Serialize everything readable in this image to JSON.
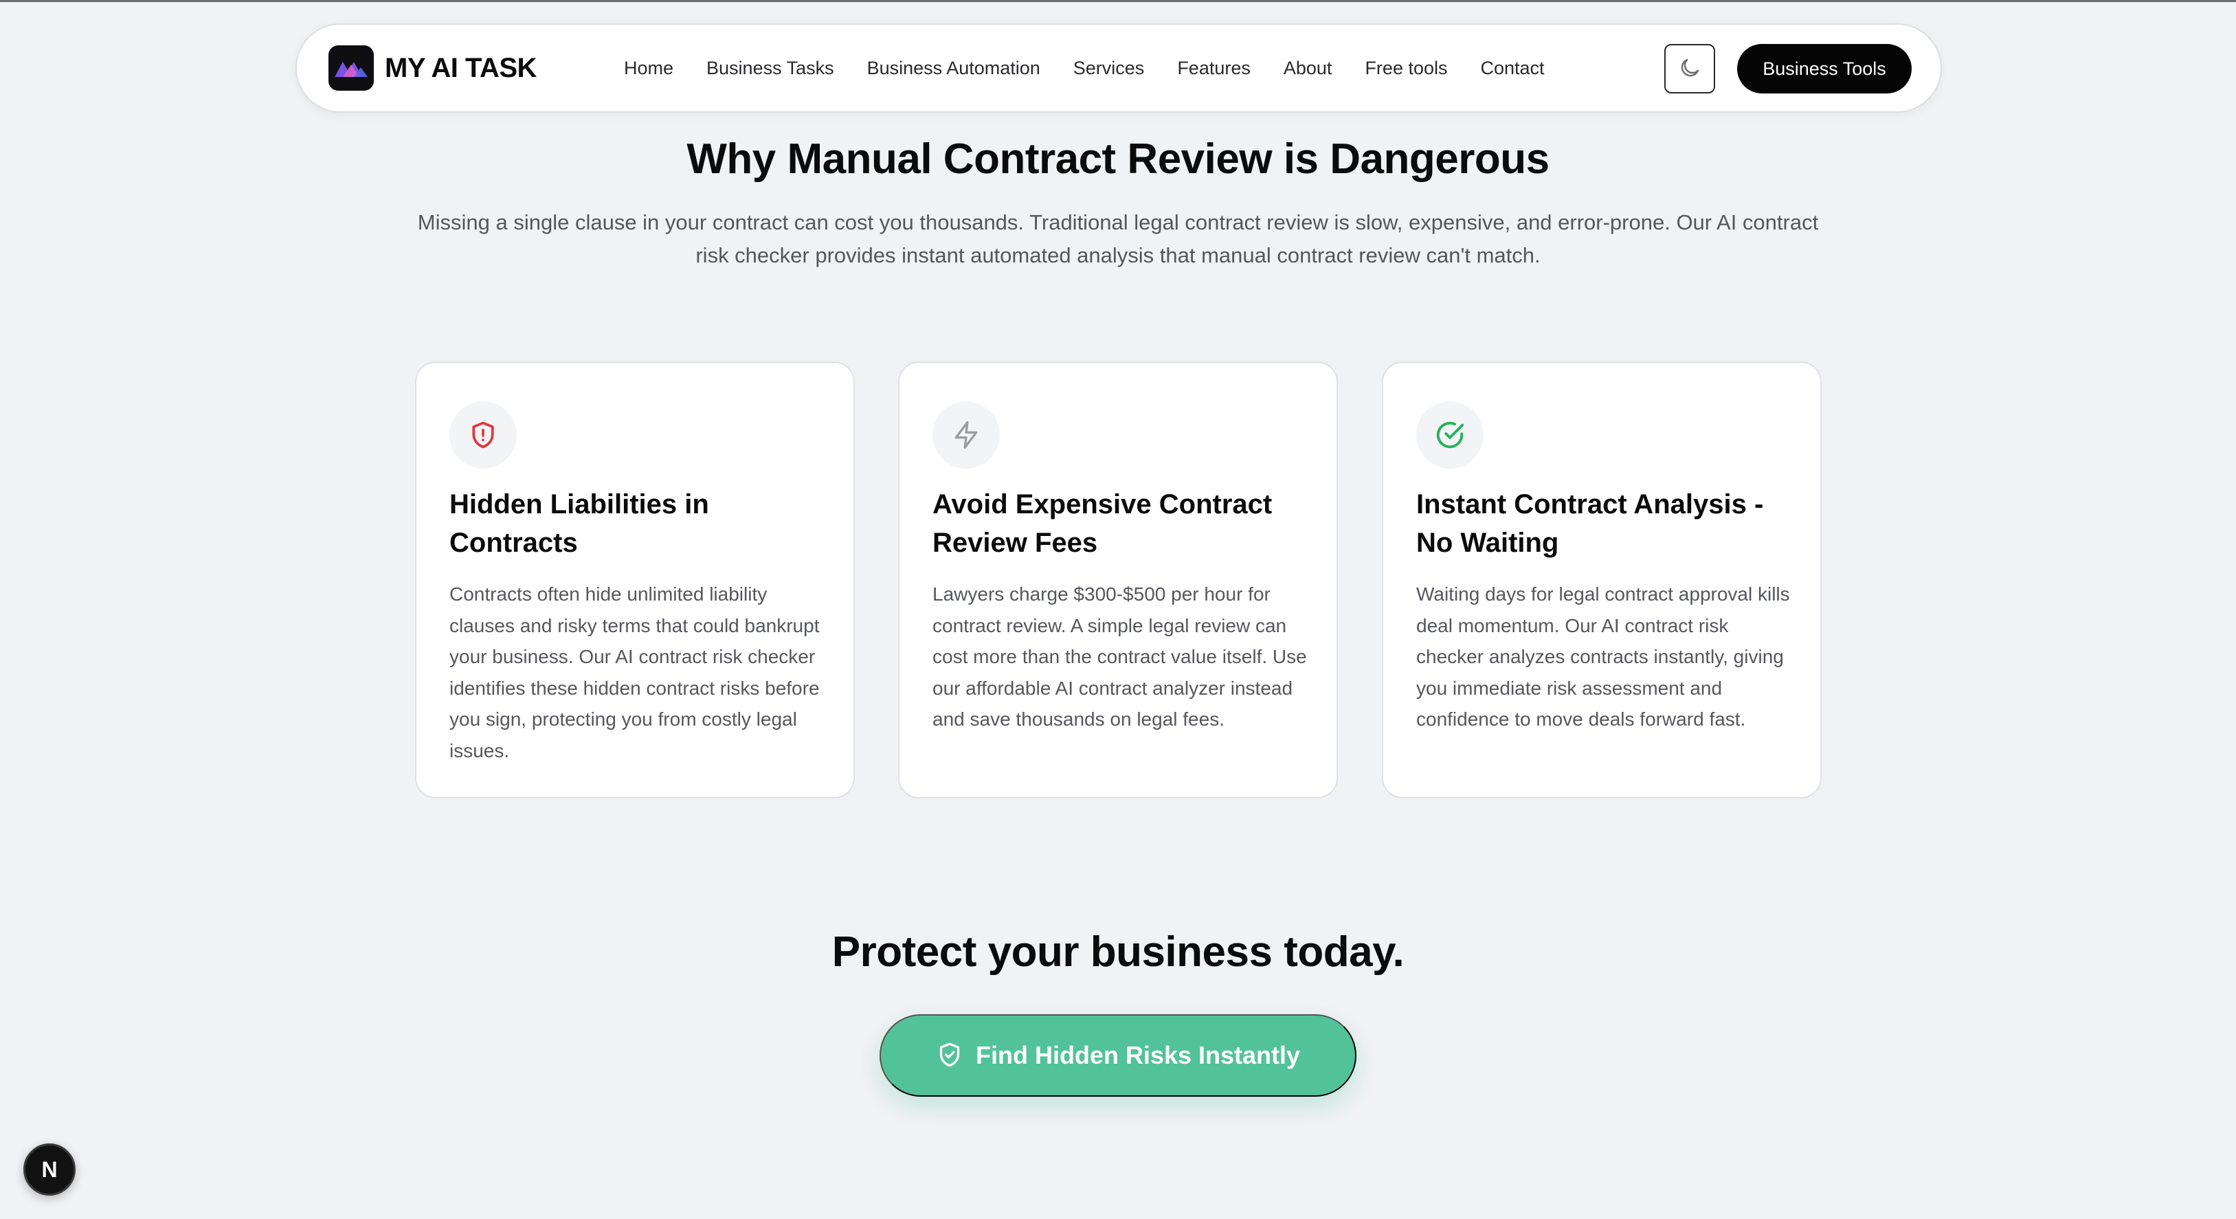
{
  "header": {
    "logo_text": "MY AI TASK",
    "nav": [
      "Home",
      "Business Tasks",
      "Business Automation",
      "Services",
      "Features",
      "About",
      "Free tools",
      "Contact"
    ],
    "theme_toggle_icon": "moon-icon",
    "cta_label": "Business Tools"
  },
  "main": {
    "heading": "Why Manual Contract Review is Dangerous",
    "intro": "Missing a single clause in your contract can cost you thousands. Traditional legal contract review is slow, expensive, and error-prone. Our AI contract risk checker provides instant automated analysis that manual contract review can't match.",
    "cards": [
      {
        "icon": "shield-alert-icon",
        "icon_color": "#e0353c",
        "title": "Hidden Liabilities in Contracts",
        "body": "Contracts often hide unlimited liability clauses and risky terms that could bankrupt your business. Our AI contract risk checker identifies these hidden contract risks before you sign, protecting you from costly legal issues."
      },
      {
        "icon": "lightning-icon",
        "icon_color": "#9a9ca2",
        "title": "Avoid Expensive Contract Review Fees",
        "body": "Lawyers charge $300-$500 per hour for contract review. A simple legal review can cost more than the contract value itself. Use our affordable AI contract analyzer instead and save thousands on legal fees."
      },
      {
        "icon": "check-circle-icon",
        "icon_color": "#22b35a",
        "title": "Instant Contract Analysis - No Waiting",
        "body": "Waiting days for legal contract approval kills deal momentum. Our AI contract risk checker analyzes contracts instantly, giving you immediate risk assessment and confidence to move deals forward fast."
      }
    ]
  },
  "cta_section": {
    "heading": "Protect your business today.",
    "button_label": "Find Hidden Risks Instantly",
    "button_color": "#52c29a"
  },
  "dev_badge": {
    "letter": "N"
  }
}
